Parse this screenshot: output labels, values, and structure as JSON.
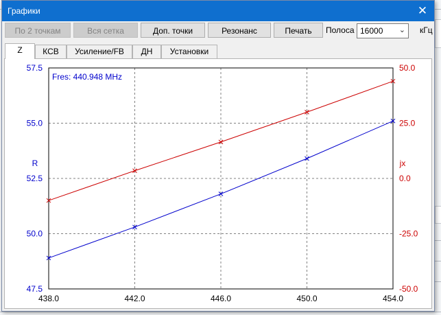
{
  "window": {
    "title": "Графики",
    "close_glyph": "✕"
  },
  "toolbar": {
    "btn_two_points": "По 2 точкам",
    "btn_full_grid": "Вся сетка",
    "btn_extra_points": "Доп. точки",
    "btn_resonance": "Резонанс",
    "btn_print": "Печать",
    "band_label": "Полоса",
    "band_value": "16000",
    "unit_label": "кГц"
  },
  "tabs": [
    {
      "label": "Z",
      "active": true
    },
    {
      "label": "КСВ",
      "active": false
    },
    {
      "label": "Усиление/FB",
      "active": false
    },
    {
      "label": "ДН",
      "active": false
    },
    {
      "label": "Установки",
      "active": false
    }
  ],
  "icons": {
    "close": "close-icon",
    "combo_arrow": "chevron-down-icon"
  },
  "colors": {
    "title_bar": "#0f6fcf",
    "r_series": "#0000cc",
    "jx_series": "#cc0000",
    "annotation": "#0000cc"
  },
  "chart_data": {
    "type": "line",
    "title": "",
    "annotation": "Fres: 440.948 MHz",
    "xlabel": "",
    "ylabel_left": "R",
    "ylabel_right": "jx",
    "xlim": [
      438.0,
      454.0
    ],
    "ylim_left": [
      47.5,
      57.5
    ],
    "ylim_right": [
      -50.0,
      50.0
    ],
    "x_ticks": [
      "438.0",
      "442.0",
      "446.0",
      "450.0",
      "454.0"
    ],
    "y_ticks_left": [
      "57.5",
      "55.0",
      "52.5",
      "50.0",
      "47.5"
    ],
    "y_ticks_right": [
      "50.0",
      "25.0",
      "0.0",
      "-25.0",
      "-50.0"
    ],
    "grid": true,
    "x": [
      438.0,
      442.0,
      446.0,
      450.0,
      454.0
    ],
    "series": [
      {
        "name": "R",
        "axis": "left",
        "values": [
          48.9,
          50.3,
          51.8,
          53.4,
          55.1
        ]
      },
      {
        "name": "jx",
        "axis": "right",
        "values": [
          -10.0,
          3.5,
          16.5,
          30.0,
          44.0
        ]
      }
    ]
  }
}
